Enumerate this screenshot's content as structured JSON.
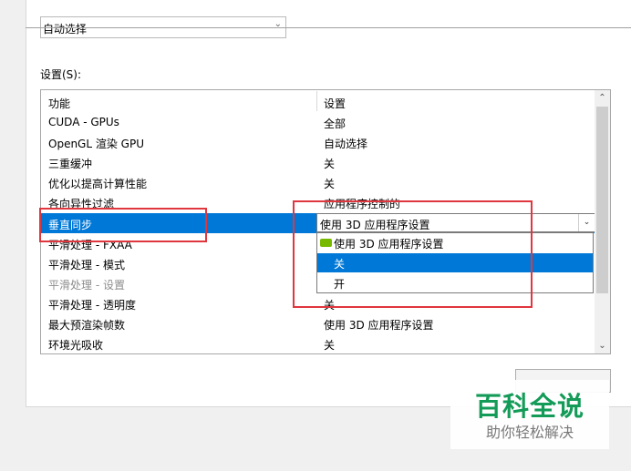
{
  "top_select": {
    "value": "自动选择"
  },
  "settings_label": "设置(S):",
  "grid": {
    "headers": {
      "feature": "功能",
      "setting": "设置"
    },
    "rows": [
      {
        "feature": "CUDA - GPUs",
        "setting": "全部"
      },
      {
        "feature": "OpenGL 渲染 GPU",
        "setting": "自动选择"
      },
      {
        "feature": "三重缓冲",
        "setting": "关"
      },
      {
        "feature": "优化以提高计算性能",
        "setting": "关"
      },
      {
        "feature": "各向异性过滤",
        "setting": "应用程序控制的"
      },
      {
        "feature": "垂直同步",
        "setting": "使用 3D 应用程序设置"
      },
      {
        "feature": "平滑处理 - FXAA",
        "setting": ""
      },
      {
        "feature": "平滑处理 - 模式",
        "setting": ""
      },
      {
        "feature": "平滑处理 - 设置",
        "setting": ""
      },
      {
        "feature": "平滑处理 - 透明度",
        "setting": "关"
      },
      {
        "feature": "最大预渲染帧数",
        "setting": "使用 3D 应用程序设置"
      },
      {
        "feature": "环境光吸收",
        "setting": "关"
      }
    ],
    "selected_row": 5
  },
  "dropdown": {
    "options": [
      "使用 3D 应用程序设置",
      "关",
      "开"
    ],
    "highlighted_index": 1
  },
  "watermark": {
    "title": "百科全说",
    "subtitle": "助你轻松解决"
  },
  "colors": {
    "selection": "#0078d7",
    "highlight_box": "#e0363e",
    "watermark_green": "#149b58",
    "nvidia_green": "#76b900"
  }
}
